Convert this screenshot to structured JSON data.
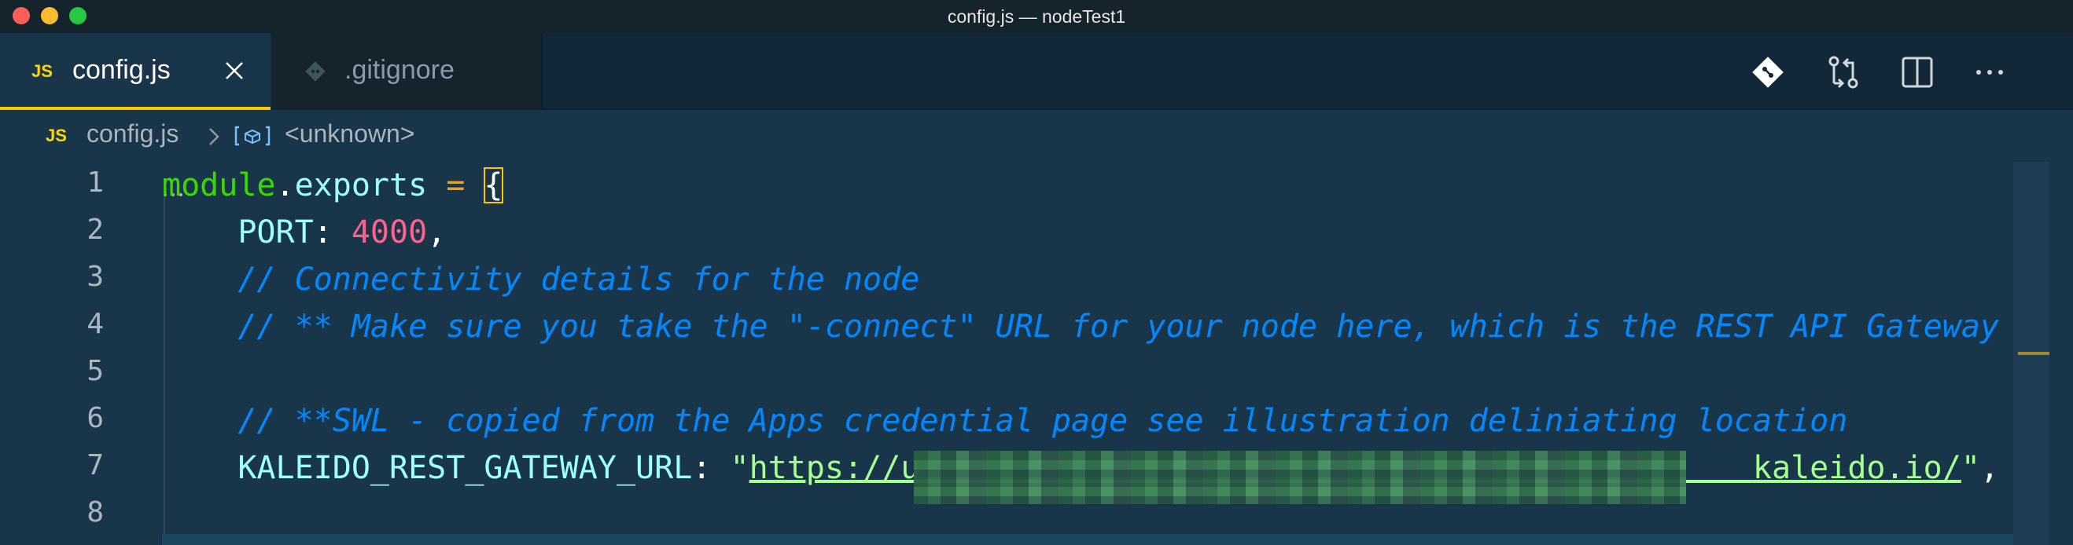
{
  "window": {
    "title": "config.js — nodeTest1"
  },
  "tabs": [
    {
      "label": "config.js",
      "icon_text": "JS",
      "active": true
    },
    {
      "label": ".gitignore",
      "icon": "git-diamond-icon",
      "active": false
    }
  ],
  "toolbar": [
    "git-lens-icon",
    "compare-changes-icon",
    "split-editor-icon",
    "more-actions-icon"
  ],
  "breadcrumb": {
    "icon_text": "JS",
    "file": "config.js",
    "symbol": "<unknown>"
  },
  "gutter": {
    "line_numbers": [
      "1",
      "2",
      "3",
      "4",
      "5",
      "6",
      "7",
      "8"
    ]
  },
  "code": {
    "l1_module": "module",
    "l1_dot": ".",
    "l1_exports": "exports",
    "l1_eq": " = ",
    "l1_brace": "{",
    "l2_indent": "    ",
    "l2_key": "PORT",
    "l2_colon": ": ",
    "l2_value": "4000",
    "l2_comma": ",",
    "l3_comment": "    // Connectivity details for the node",
    "l4_comment": "    // ** Make sure you take the \"-connect\" URL for your node here, which is the REST API Gateway *",
    "l6_comment": "    // **SWL - copied from the Apps credential page see illustration deliniating location",
    "l7_key": "    KALEIDO_REST_GATEWAY_URL",
    "l7_colon": ": ",
    "l7_quote_open": "\"",
    "l7_url_visible_start": "https://u",
    "l7_url_gap": "                                            ",
    "l7_url_visible_end": "kaleido.io/",
    "l7_quote_close": "\"",
    "l7_comma": ","
  },
  "colors": {
    "background": "#193549",
    "tab_accent": "#ffc600",
    "comment": "#0088ff",
    "number": "#ff628c",
    "string": "#a5ff90"
  }
}
